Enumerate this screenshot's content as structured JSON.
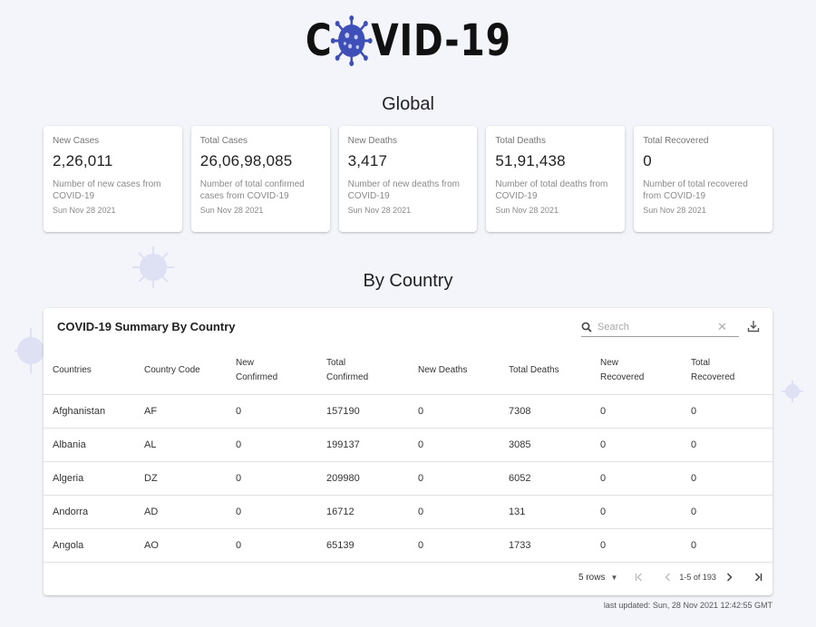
{
  "logo": {
    "text_before": "C",
    "text_after": "VID-19",
    "accent": "#3f4fb8"
  },
  "global": {
    "title": "Global",
    "cards": [
      {
        "label": "New Cases",
        "value": "2,26,011",
        "desc": "Number of new cases from COVID-19",
        "date": "Sun Nov 28 2021"
      },
      {
        "label": "Total Cases",
        "value": "26,06,98,085",
        "desc": "Number of total confirmed cases from COVID-19",
        "date": "Sun Nov 28 2021"
      },
      {
        "label": "New Deaths",
        "value": "3,417",
        "desc": "Number of new deaths from COVID-19",
        "date": "Sun Nov 28 2021"
      },
      {
        "label": "Total Deaths",
        "value": "51,91,438",
        "desc": "Number of total deaths from COVID-19",
        "date": "Sun Nov 28 2021"
      },
      {
        "label": "Total Recovered",
        "value": "0",
        "desc": "Number of total recovered from COVID-19",
        "date": "Sun Nov 28 2021"
      }
    ]
  },
  "by_country": {
    "title": "By Country",
    "table_title": "COVID-19 Summary By Country",
    "search": {
      "placeholder": "Search",
      "value": ""
    },
    "icons": {
      "search": "search-icon",
      "clear": "close-icon",
      "download": "download-icon"
    },
    "columns": [
      "Countries",
      "Country Code",
      "New Confirmed",
      "Total Confirmed",
      "New Deaths",
      "Total Deaths",
      "New Recovered",
      "Total Recovered"
    ],
    "rows": [
      [
        "Afghanistan",
        "AF",
        "0",
        "157190",
        "0",
        "7308",
        "0",
        "0"
      ],
      [
        "Albania",
        "AL",
        "0",
        "199137",
        "0",
        "3085",
        "0",
        "0"
      ],
      [
        "Algeria",
        "DZ",
        "0",
        "209980",
        "0",
        "6052",
        "0",
        "0"
      ],
      [
        "Andorra",
        "AD",
        "0",
        "16712",
        "0",
        "131",
        "0",
        "0"
      ],
      [
        "Angola",
        "AO",
        "0",
        "65139",
        "0",
        "1733",
        "0",
        "0"
      ]
    ],
    "pagination": {
      "rows_per_page": "5 rows",
      "range": "1-5 of 193"
    }
  },
  "footer": {
    "last_updated": "last updated: Sun, 28 Nov 2021 12:42:55 GMT"
  }
}
